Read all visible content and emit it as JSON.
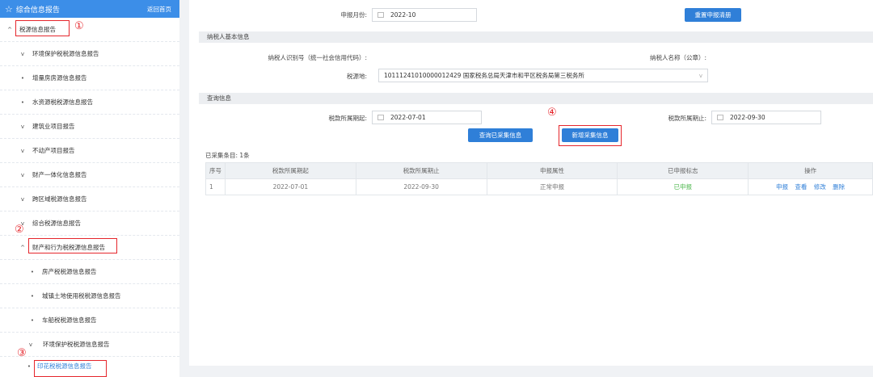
{
  "sidebar": {
    "title": "综合信息报告",
    "back_label": "返回首页",
    "items": [
      {
        "label": "税源信息报告",
        "indicator": "^"
      },
      {
        "label": "环境保护税税源信息报告",
        "indicator": "v"
      },
      {
        "label": "增量房房源信息报告",
        "indicator": "•"
      },
      {
        "label": "水资源税税源信息报告",
        "indicator": "•"
      },
      {
        "label": "建筑业项目报告",
        "indicator": "v"
      },
      {
        "label": "不动产项目报告",
        "indicator": "v"
      },
      {
        "label": "财产一体化信息报告",
        "indicator": "v"
      },
      {
        "label": "跨区域税源信息报告",
        "indicator": "v"
      },
      {
        "label": "综合税源信息报告",
        "indicator": "v"
      },
      {
        "label": "财产和行为税税源信息报告",
        "indicator": "^"
      },
      {
        "label": "房产税税源信息报告",
        "indicator": "•"
      },
      {
        "label": "城镇土地使用税税源信息报告",
        "indicator": "•"
      },
      {
        "label": "车船税税源信息报告",
        "indicator": "•"
      },
      {
        "label": "环境保护税税源信息报告",
        "indicator": "v"
      },
      {
        "label": "印花税税源信息报告",
        "indicator": "•"
      }
    ]
  },
  "annotations": {
    "one": "①",
    "two": "②",
    "three": "③",
    "four": "④"
  },
  "top": {
    "period_label": "申报月份:",
    "period_value": "2022-10",
    "reset_button": "重置申报清册"
  },
  "taxpayer": {
    "section_title": "纳税人基本信息",
    "id_label": "纳税人识别号（统一社会信用代码）:",
    "name_label": "纳税人名称（公章）:",
    "tax_office_label": "税源地:",
    "tax_office_value": "10111241010000012429 国家税务总局天津市和平区税务局第三税务所"
  },
  "query": {
    "section_title": "查询信息",
    "start_label": "税款所属期起:",
    "start_value": "2022-07-01",
    "end_label": "税款所属期止:",
    "end_value": "2022-09-30",
    "query_button": "查询已采集信息",
    "new_button": "新增采集信息"
  },
  "results": {
    "count_text": "已采集条目: 1条",
    "columns": [
      "序号",
      "税款所属期起",
      "税款所属期止",
      "申报属性",
      "已申报标志",
      "操作"
    ],
    "rows": [
      {
        "index": "1",
        "start": "2022-07-01",
        "end": "2022-09-30",
        "attr": "正常申报",
        "status": "已申报"
      }
    ],
    "actions": [
      "申报",
      "查看",
      "修改",
      "删除"
    ]
  }
}
